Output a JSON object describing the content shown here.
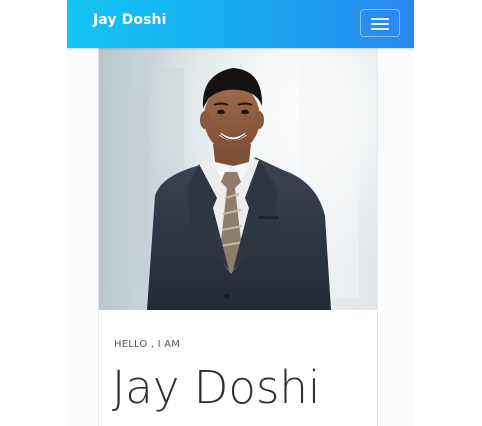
{
  "navbar": {
    "brand": "Jay Doshi",
    "gradient_start": "#13c5f5",
    "gradient_end": "#2a86ec",
    "menu_icon": "hamburger-menu-icon"
  },
  "hero": {
    "photo": "portrait-photo",
    "greeting": "HELLO , I AM",
    "name": "Jay Doshi"
  }
}
